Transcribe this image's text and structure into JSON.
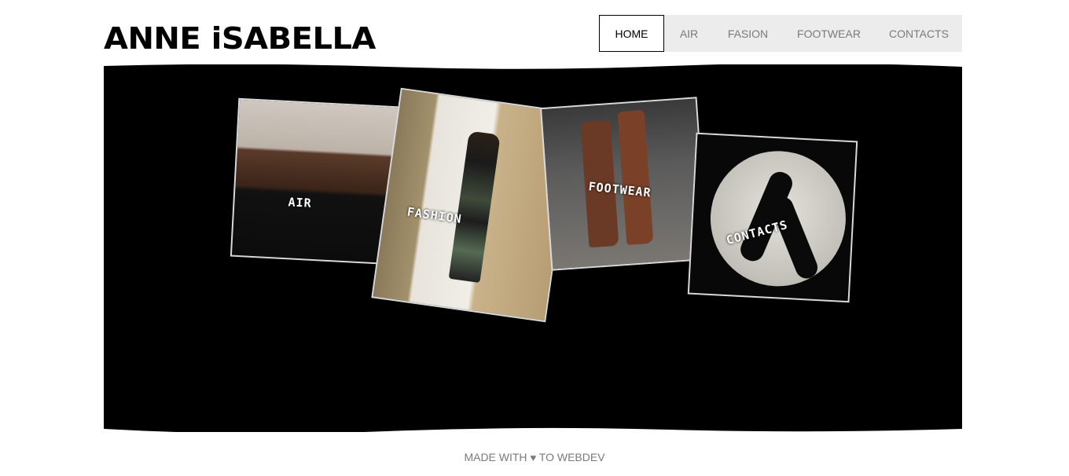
{
  "site": {
    "logo_text": "ANNE iSABELLA"
  },
  "nav": {
    "items": [
      {
        "label": "HOME",
        "active": true
      },
      {
        "label": "AIR"
      },
      {
        "label": "FASION"
      },
      {
        "label": "FOOTWEAR"
      },
      {
        "label": "CONTACTS"
      }
    ]
  },
  "gallery": {
    "cards": [
      {
        "label": "AIR"
      },
      {
        "label": "FASHION"
      },
      {
        "label": "FOOTWEAR"
      },
      {
        "label": "CONTACTS"
      }
    ]
  },
  "footer": {
    "prefix": "MADE WITH",
    "heart_icon": "heart-icon",
    "suffix": "TO WEBDEV"
  },
  "colors": {
    "background": "#ffffff",
    "hero": "#000000",
    "nav_bg": "#ececec",
    "nav_text": "#7a7a7a"
  }
}
